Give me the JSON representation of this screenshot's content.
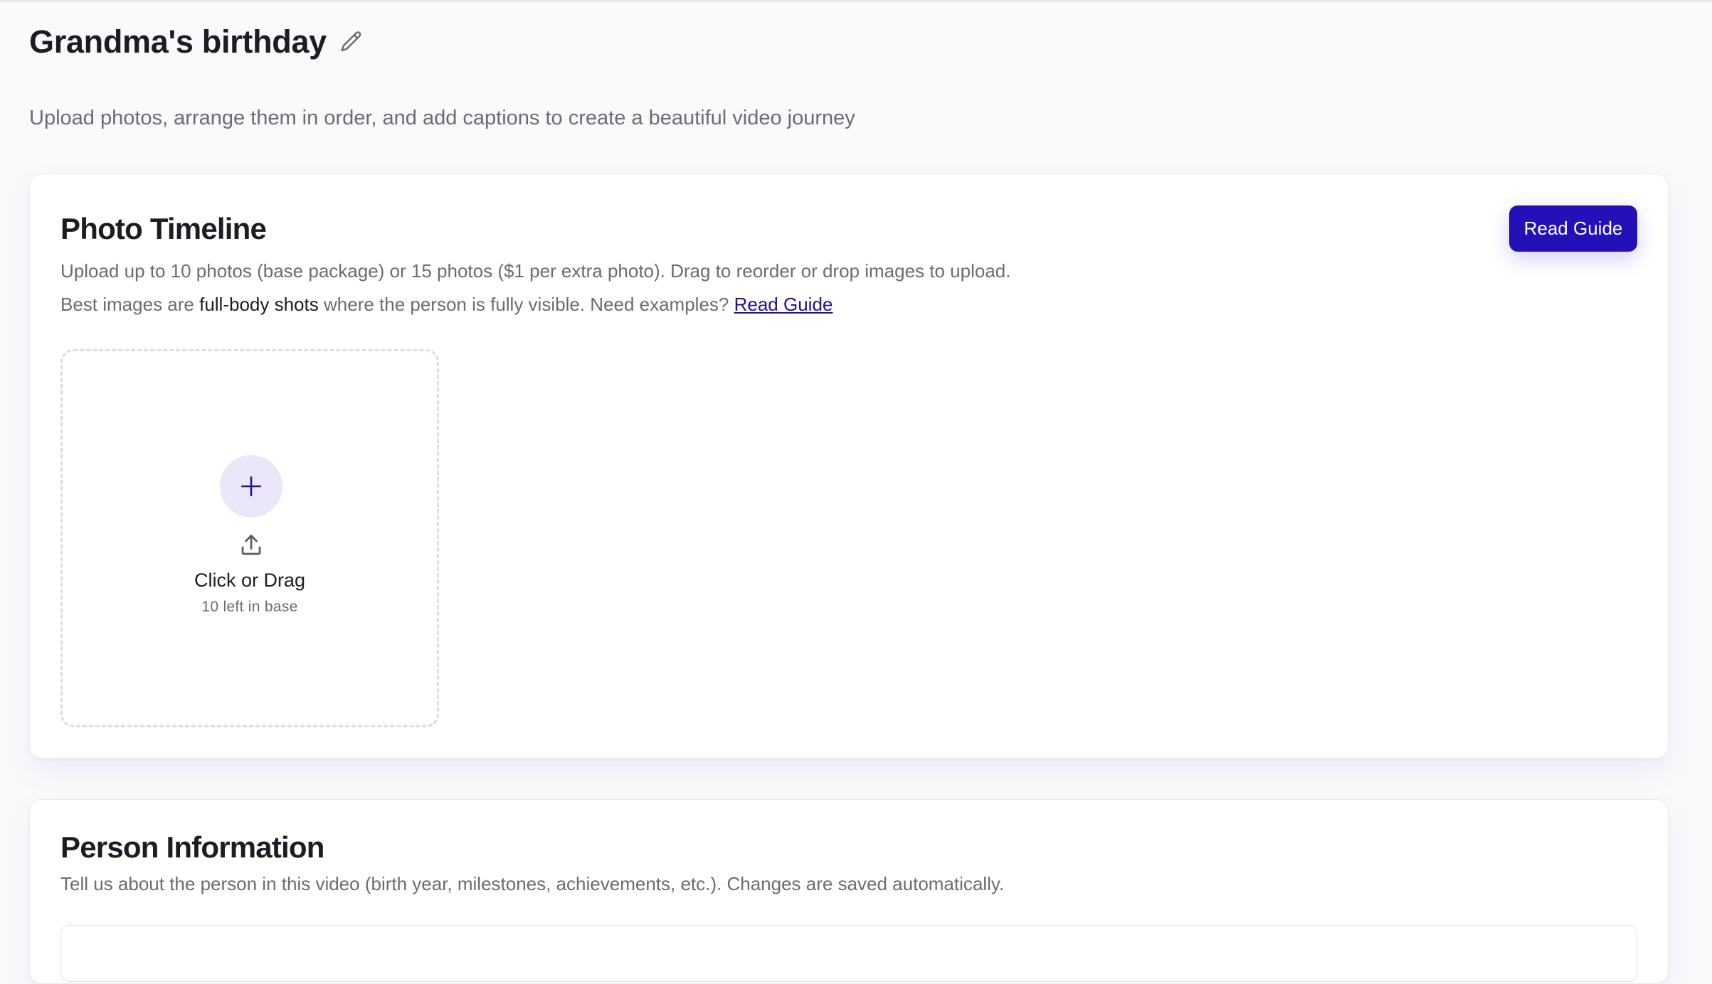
{
  "page": {
    "title": "Grandma's birthday",
    "subtitle": "Upload photos, arrange them in order, and add captions to create a beautiful video journey"
  },
  "icons": {
    "edit": "pencil-icon",
    "add": "plus-icon",
    "upload": "upload-icon"
  },
  "colors": {
    "accent": "#2410b8",
    "accent_soft": "#ebe7f8",
    "text_primary": "#1c1c22",
    "text_secondary": "#6b6b73"
  },
  "timeline": {
    "heading": "Photo Timeline",
    "description": "Upload up to 10 photos (base package) or 15 photos ($1 per extra photo). Drag to reorder or drop images to upload.",
    "tip_prefix": "Best images are ",
    "tip_emphasis": "full-body shots",
    "tip_suffix": " where the person is fully visible. Need examples? ",
    "tip_link": "Read Guide",
    "read_guide_button": "Read Guide",
    "upload": {
      "label": "Click or Drag",
      "remaining": "10 left in base"
    }
  },
  "person": {
    "heading": "Person Information",
    "description": "Tell us about the person in this video (birth year, milestones, achievements, etc.). Changes are saved automatically."
  }
}
